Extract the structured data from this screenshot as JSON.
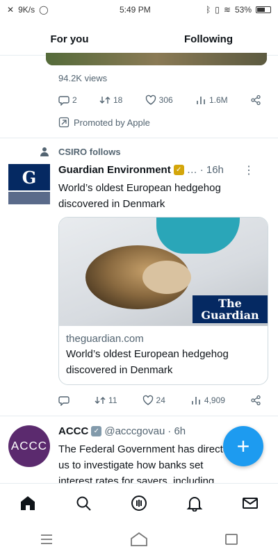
{
  "status_bar": {
    "net_speed": "9K/s",
    "time": "5:49 PM",
    "battery": "53%"
  },
  "tabs": [
    {
      "label": "For you"
    },
    {
      "label": "Following"
    }
  ],
  "prev_tweet": {
    "views": "94.2K views",
    "reply_count": "2",
    "retweet_count": "18",
    "like_count": "306",
    "view_count": "1.6M",
    "promoted": "Promoted by Apple"
  },
  "guardian_tweet": {
    "social_context": "CSIRO follows",
    "name": "Guardian Environment",
    "time_ago": "16h",
    "text": "World’s oldest European hedgehog discovered in Denmark",
    "avatar_letter": "G",
    "card": {
      "logo_line1": "The",
      "logo_line2": "Guardian",
      "domain": "theguardian.com",
      "title": "World’s oldest European hedgehog discovered in Denmark"
    },
    "retweet_count": "11",
    "like_count": "24",
    "view_count": "4,909"
  },
  "accc_tweet": {
    "name": "ACCC",
    "handle": "@acccgovau",
    "time_ago": "6h",
    "avatar_text": "ACCC",
    "text_line1": "The Federal Government has directed",
    "text_line2": "us to investigate how banks set",
    "text_line3": "interest rates for savers, including"
  },
  "fab": {
    "label": "+"
  },
  "colors": {
    "accent": "#1d9bf0",
    "guardian_navy": "#052962",
    "accc_purple": "#5b2a6e",
    "verified_gold": "#d4a60b"
  }
}
